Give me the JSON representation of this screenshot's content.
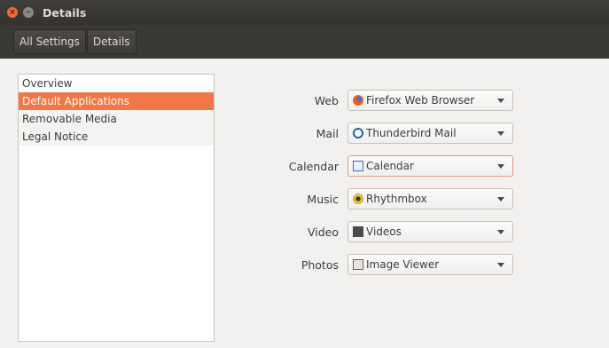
{
  "window": {
    "title": "Details",
    "close_glyph": "×",
    "minimize_glyph": "–"
  },
  "breadcrumbs": [
    "All Settings",
    "Details"
  ],
  "sidebar": {
    "items": [
      {
        "label": "Overview"
      },
      {
        "label": "Default Applications"
      },
      {
        "label": "Removable Media"
      },
      {
        "label": "Legal Notice"
      }
    ],
    "selected": "Default Applications"
  },
  "defaults": [
    {
      "label": "Web",
      "value": "Firefox Web Browser",
      "icon": "firefox-icon"
    },
    {
      "label": "Mail",
      "value": "Thunderbird Mail",
      "icon": "thunderbird-icon"
    },
    {
      "label": "Calendar",
      "value": "Calendar",
      "icon": "calendar-icon"
    },
    {
      "label": "Music",
      "value": "Rhythmbox",
      "icon": "rhythmbox-icon"
    },
    {
      "label": "Video",
      "value": "Videos",
      "icon": "videos-icon"
    },
    {
      "label": "Photos",
      "value": "Image Viewer",
      "icon": "image-viewer-icon"
    }
  ],
  "colors": {
    "accent": "#f07746",
    "titlebar": "#3c3b37",
    "background": "#f2f1f0"
  }
}
